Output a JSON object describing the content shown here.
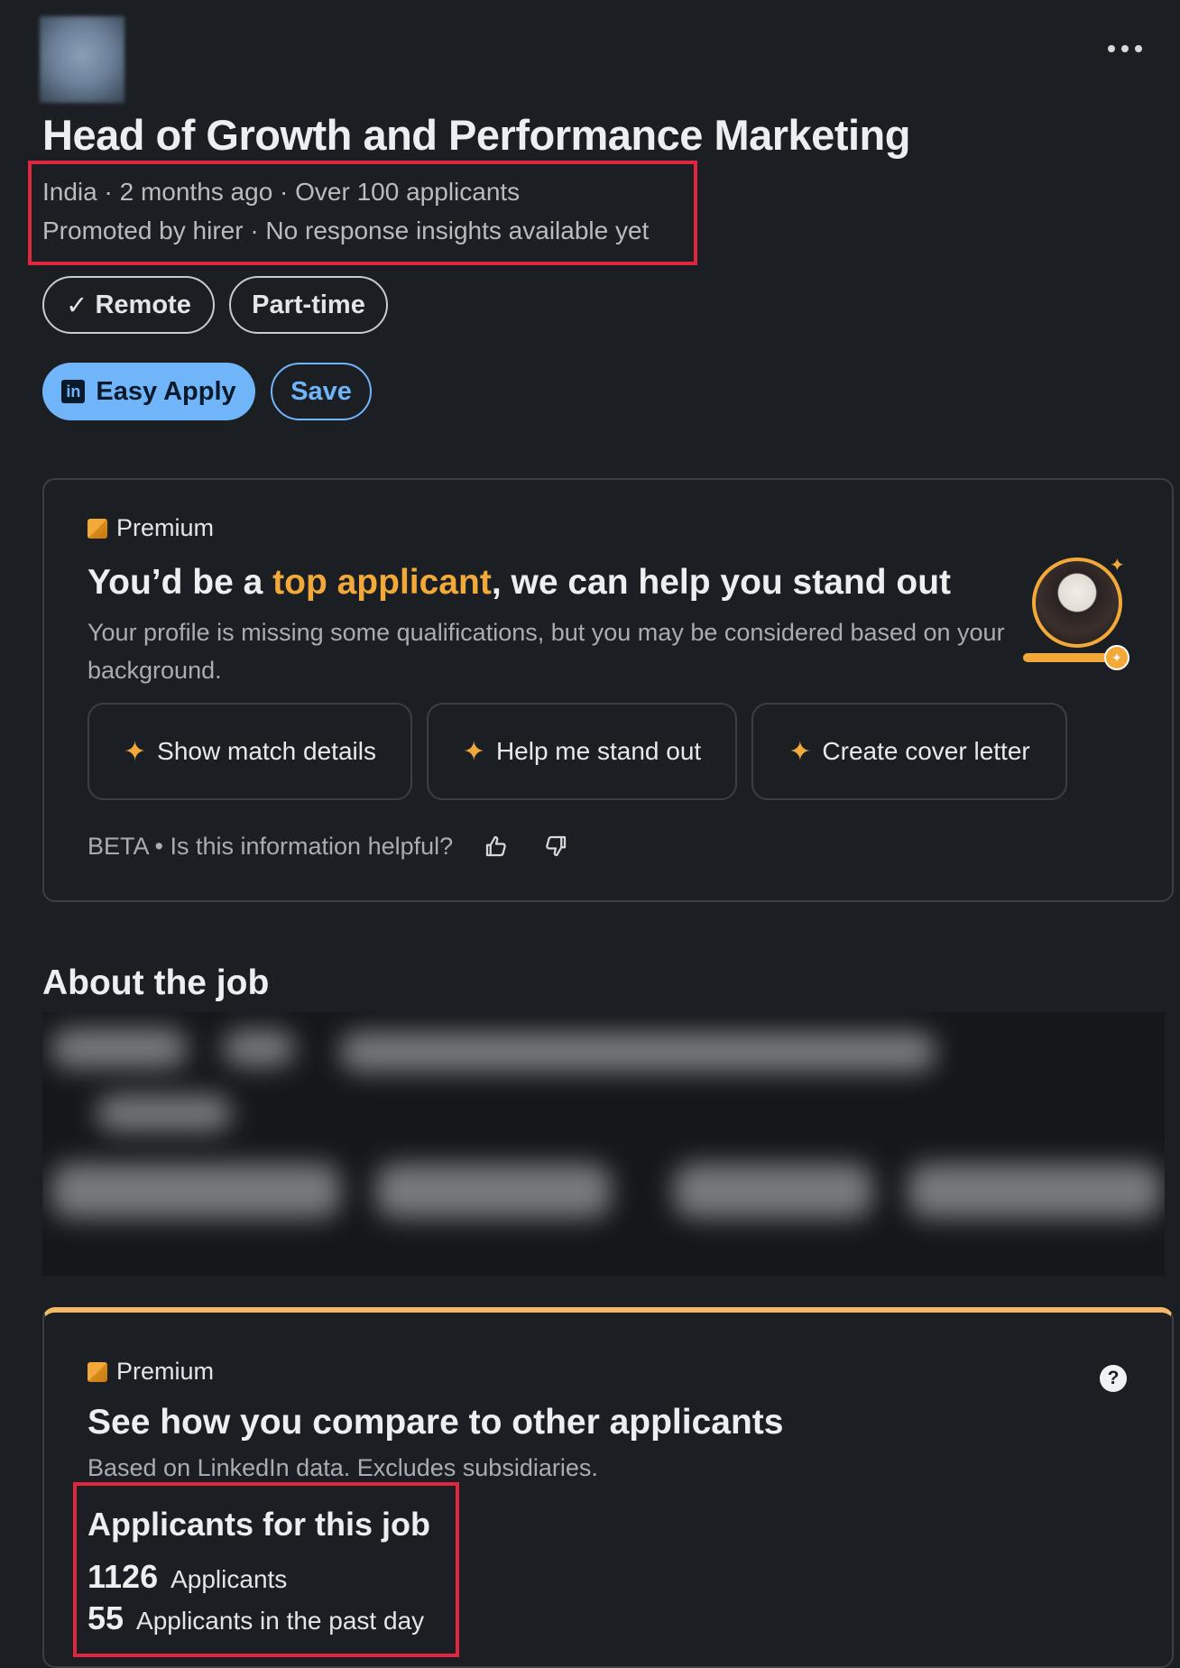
{
  "job": {
    "title": "Head of Growth and Performance Marketing",
    "meta_line1": "India · 2 months ago · Over 100 applicants",
    "meta_line2": "Promoted by hirer · No response insights available yet",
    "tags": [
      "Remote",
      "Part-time"
    ],
    "check_glyph": "✓"
  },
  "actions": {
    "easy_apply_label": "Easy Apply",
    "save_label": "Save",
    "linkedin_glyph": "in"
  },
  "premium_card": {
    "badge_label": "Premium",
    "title_prefix": "You’d be a ",
    "title_accent": "top applicant",
    "title_suffix": ", we can help you stand out",
    "description": "Your profile is missing some qualifications, but you may be considered based on your background.",
    "buttons": [
      "Show match details",
      "Help me stand out",
      "Create cover letter"
    ],
    "feedback_label": "BETA • Is this information helpful?",
    "accent_color": "#f3a93a"
  },
  "about": {
    "title": "About the job"
  },
  "compare_card": {
    "badge_label": "Premium",
    "title": "See how you compare to other applicants",
    "subtitle": "Based on LinkedIn data. Excludes subsidiaries.",
    "stats_title": "Applicants for this job",
    "total_count": "1126",
    "total_label": "Applicants",
    "recent_count": "55",
    "recent_label": "Applicants in the past day",
    "help_glyph": "?"
  },
  "icons": {
    "more": "more-horizontal-icon",
    "sparkle": "✦"
  },
  "colors": {
    "background": "#1b1f23",
    "primary_blue": "#70b5f9",
    "premium_gold": "#f3a93a",
    "highlight_red": "#e0263f"
  }
}
